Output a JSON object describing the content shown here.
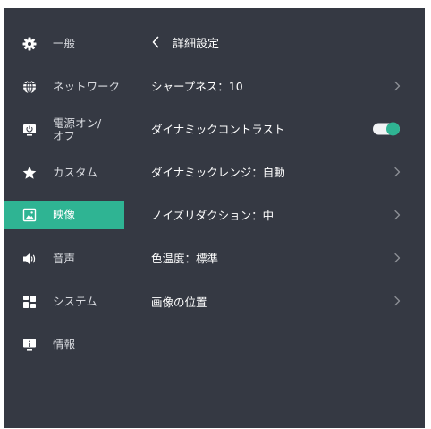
{
  "sidebar": {
    "items": [
      {
        "label": "一般",
        "icon": "gear-icon"
      },
      {
        "label": "ネットワーク",
        "icon": "globe-icon"
      },
      {
        "label": "電源オン/\nオフ",
        "icon": "power-icon"
      },
      {
        "label": "カスタム",
        "icon": "star-icon"
      },
      {
        "label": "映像",
        "icon": "picture-icon"
      },
      {
        "label": "音声",
        "icon": "speaker-icon"
      },
      {
        "label": "システム",
        "icon": "system-grid-icon"
      },
      {
        "label": "情報",
        "icon": "info-monitor-icon"
      }
    ],
    "active_index": 4
  },
  "header": {
    "title": "詳細設定"
  },
  "settings": [
    {
      "label": "シャープネス：10",
      "control": "chevron"
    },
    {
      "label": "ダイナミックコントラスト",
      "control": "toggle",
      "value": true
    },
    {
      "label": "ダイナミックレンジ：自動",
      "control": "chevron"
    },
    {
      "label": "ノイズリダクション：中",
      "control": "chevron"
    },
    {
      "label": "色温度：標準",
      "control": "chevron"
    },
    {
      "label": "画像の位置",
      "control": "chevron"
    }
  ],
  "colors": {
    "background": "#353943",
    "accent": "#2fb493",
    "text": "#ffffff",
    "divider": "#454953"
  }
}
